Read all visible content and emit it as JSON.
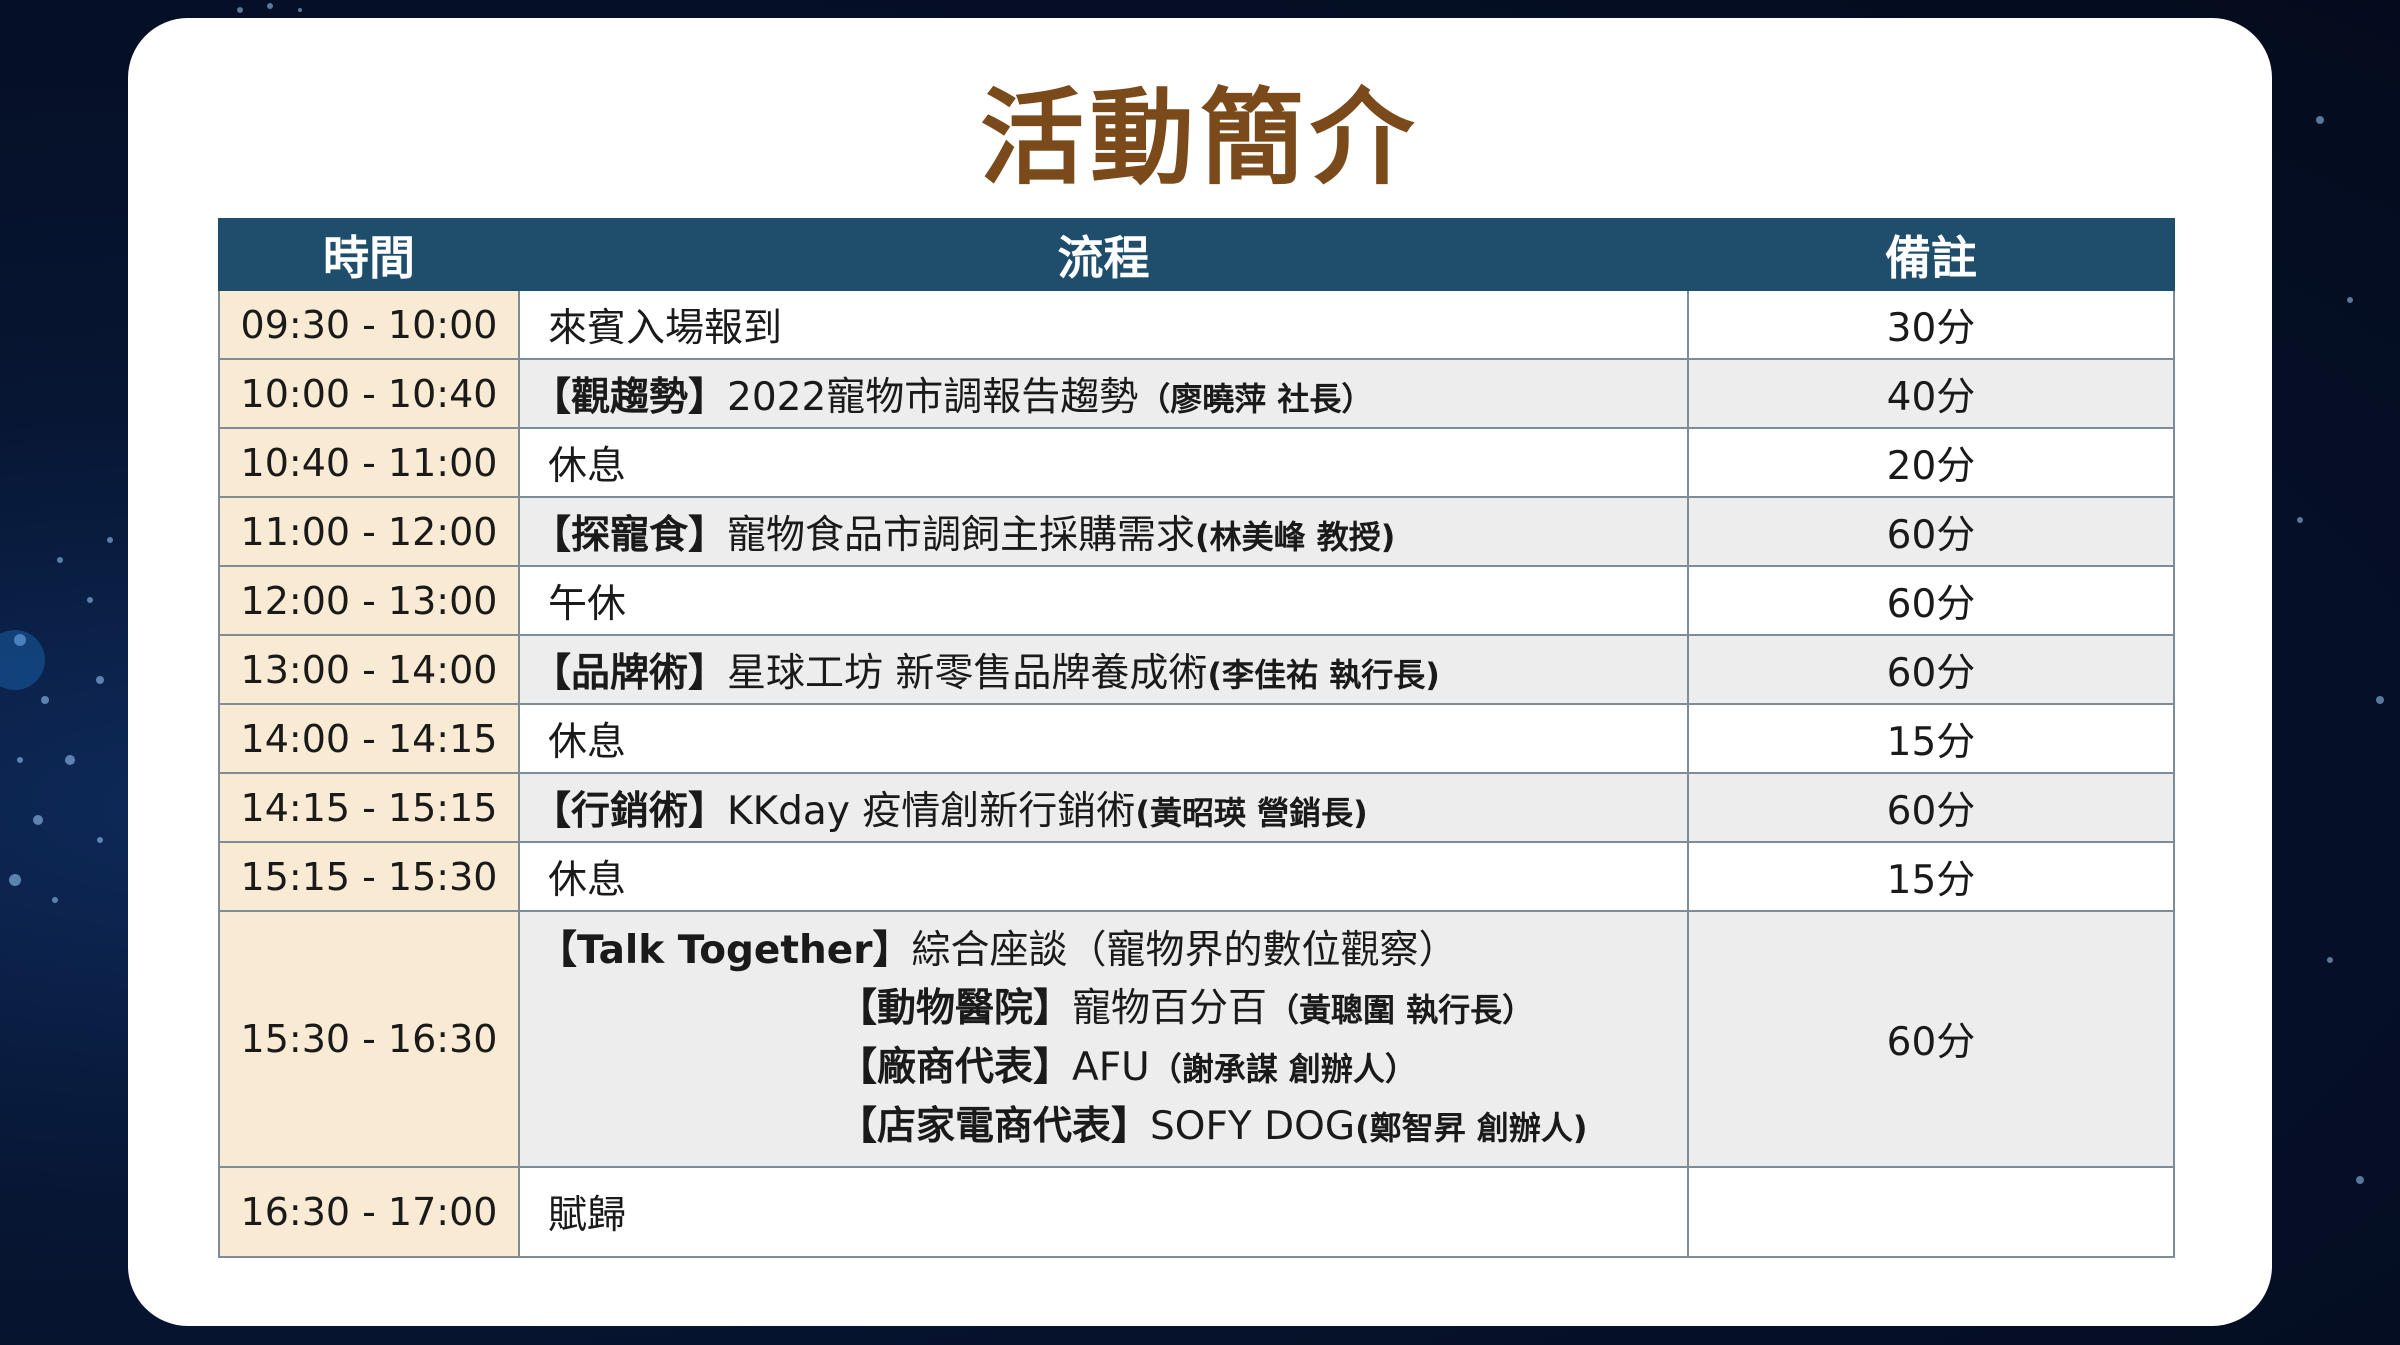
{
  "title": "活動簡介",
  "colors": {
    "header_bg": "#1f4e6d",
    "title": "#7a4a1a",
    "time_bg": "#f9ebd3",
    "row_shade": "#ededed"
  },
  "table": {
    "headers": [
      "時間",
      "流程",
      "備註"
    ],
    "rows": [
      {
        "time": "09:30 - 10:00",
        "tag": "",
        "text": "來賓入場報到",
        "speaker": "",
        "note": "30分"
      },
      {
        "time": "10:00 - 10:40",
        "tag": "【觀趨勢】",
        "text": "2022寵物市調報告趨勢",
        "speaker": "（廖曉萍 社長）",
        "note": "40分"
      },
      {
        "time": "10:40 - 11:00",
        "tag": "",
        "text": "休息",
        "speaker": "",
        "note": "20分"
      },
      {
        "time": "11:00 - 12:00",
        "tag": "【探寵食】",
        "text": "寵物食品市調飼主採購需求",
        "speaker": "(林美峰 教授)",
        "note": "60分"
      },
      {
        "time": "12:00 - 13:00",
        "tag": "",
        "text": "午休",
        "speaker": "",
        "note": "60分"
      },
      {
        "time": "13:00 - 14:00",
        "tag": "【品牌術】",
        "text": "星球工坊 新零售品牌養成術",
        "speaker": "(李佳祐 執行長)",
        "note": "60分"
      },
      {
        "time": "14:00 - 14:15",
        "tag": "",
        "text": "休息",
        "speaker": "",
        "note": "15分"
      },
      {
        "time": "14:15 - 15:15",
        "tag": "【行銷術】",
        "text": "KKday 疫情創新行銷術",
        "speaker": "(黃昭瑛 營銷長)",
        "note": "60分"
      },
      {
        "time": "15:15 - 15:30",
        "tag": "",
        "text": "休息",
        "speaker": "",
        "note": "15分"
      }
    ],
    "panel": {
      "time": "15:30 - 16:30",
      "note": "60分",
      "lines": [
        {
          "tag": "【Talk Together】",
          "text": "綜合座談（寵物界的數位觀察）",
          "speaker": ""
        },
        {
          "tag": "【動物醫院】",
          "text": "寵物百分百",
          "speaker": "（黃聰圍 執行長）"
        },
        {
          "tag": "【廠商代表】",
          "text": "AFU",
          "speaker": "（謝承謀 創辦人）"
        },
        {
          "tag": "【店家電商代表】",
          "text": "SOFY DOG",
          "speaker": "(鄭智昇 創辦人)"
        }
      ]
    },
    "last": {
      "time": "16:30 - 17:00",
      "text": "賦歸",
      "note": ""
    }
  }
}
